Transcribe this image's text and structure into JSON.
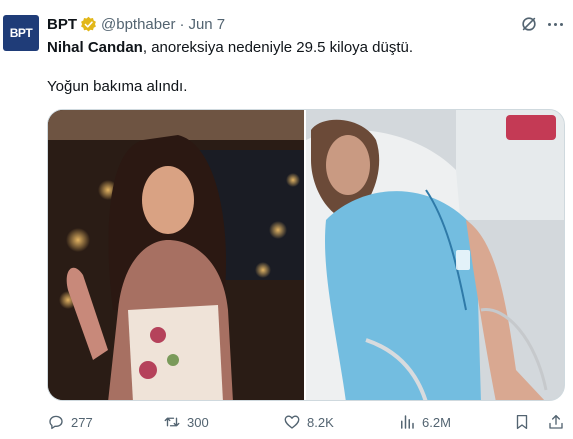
{
  "author": {
    "avatar_text": "BPT",
    "name": "BPT",
    "handle": "@bpthaber",
    "separator": "·",
    "date": "Jun 7"
  },
  "tweet": {
    "line1_bold": "Nihal Candan",
    "line1_rest": ", anoreksiya nedeniyle 29.5 kiloya düştü.",
    "line2": "Yoğun bakıma alındı."
  },
  "actions": {
    "replies": "277",
    "reposts": "300",
    "likes": "8.2K",
    "views": "6.2M"
  },
  "colors": {
    "text": "#0f1419",
    "secondary": "#536471",
    "verified": "#e2b719",
    "avatar_bg": "#1f3c78"
  },
  "icons": [
    "verified-icon",
    "grok-icon",
    "more-icon",
    "reply-icon",
    "repost-icon",
    "like-icon",
    "views-icon",
    "bookmark-icon",
    "share-icon"
  ]
}
